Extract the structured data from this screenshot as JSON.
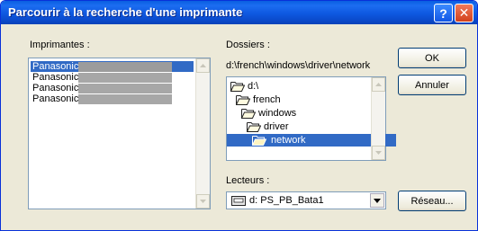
{
  "window": {
    "title": "Parcourir à la recherche d'une imprimante",
    "help_glyph": "?",
    "close_glyph": "✕"
  },
  "printers": {
    "label": "Imprimantes :",
    "items": [
      {
        "name": "Panasonic",
        "selected": true
      },
      {
        "name": "Panasonic",
        "selected": false
      },
      {
        "name": "Panasonic",
        "selected": false
      },
      {
        "name": "Panasonic",
        "selected": false
      }
    ]
  },
  "folders": {
    "label": "Dossiers :",
    "path": "d:\\french\\windows\\driver\\network",
    "items": [
      {
        "name": "d:\\",
        "level": 0,
        "selected": false
      },
      {
        "name": "french",
        "level": 1,
        "selected": false
      },
      {
        "name": "windows",
        "level": 2,
        "selected": false
      },
      {
        "name": "driver",
        "level": 3,
        "selected": false
      },
      {
        "name": "network",
        "level": 4,
        "selected": true
      }
    ]
  },
  "drives": {
    "label": "Lecteurs :",
    "selected": "d: PS_PB_Bata1"
  },
  "buttons": {
    "ok": "OK",
    "cancel": "Annuler",
    "network": "Réseau..."
  },
  "colors": {
    "selection": "#316ac5",
    "dialog_bg": "#ece9d8",
    "title_bar": "#0a5fe0"
  }
}
